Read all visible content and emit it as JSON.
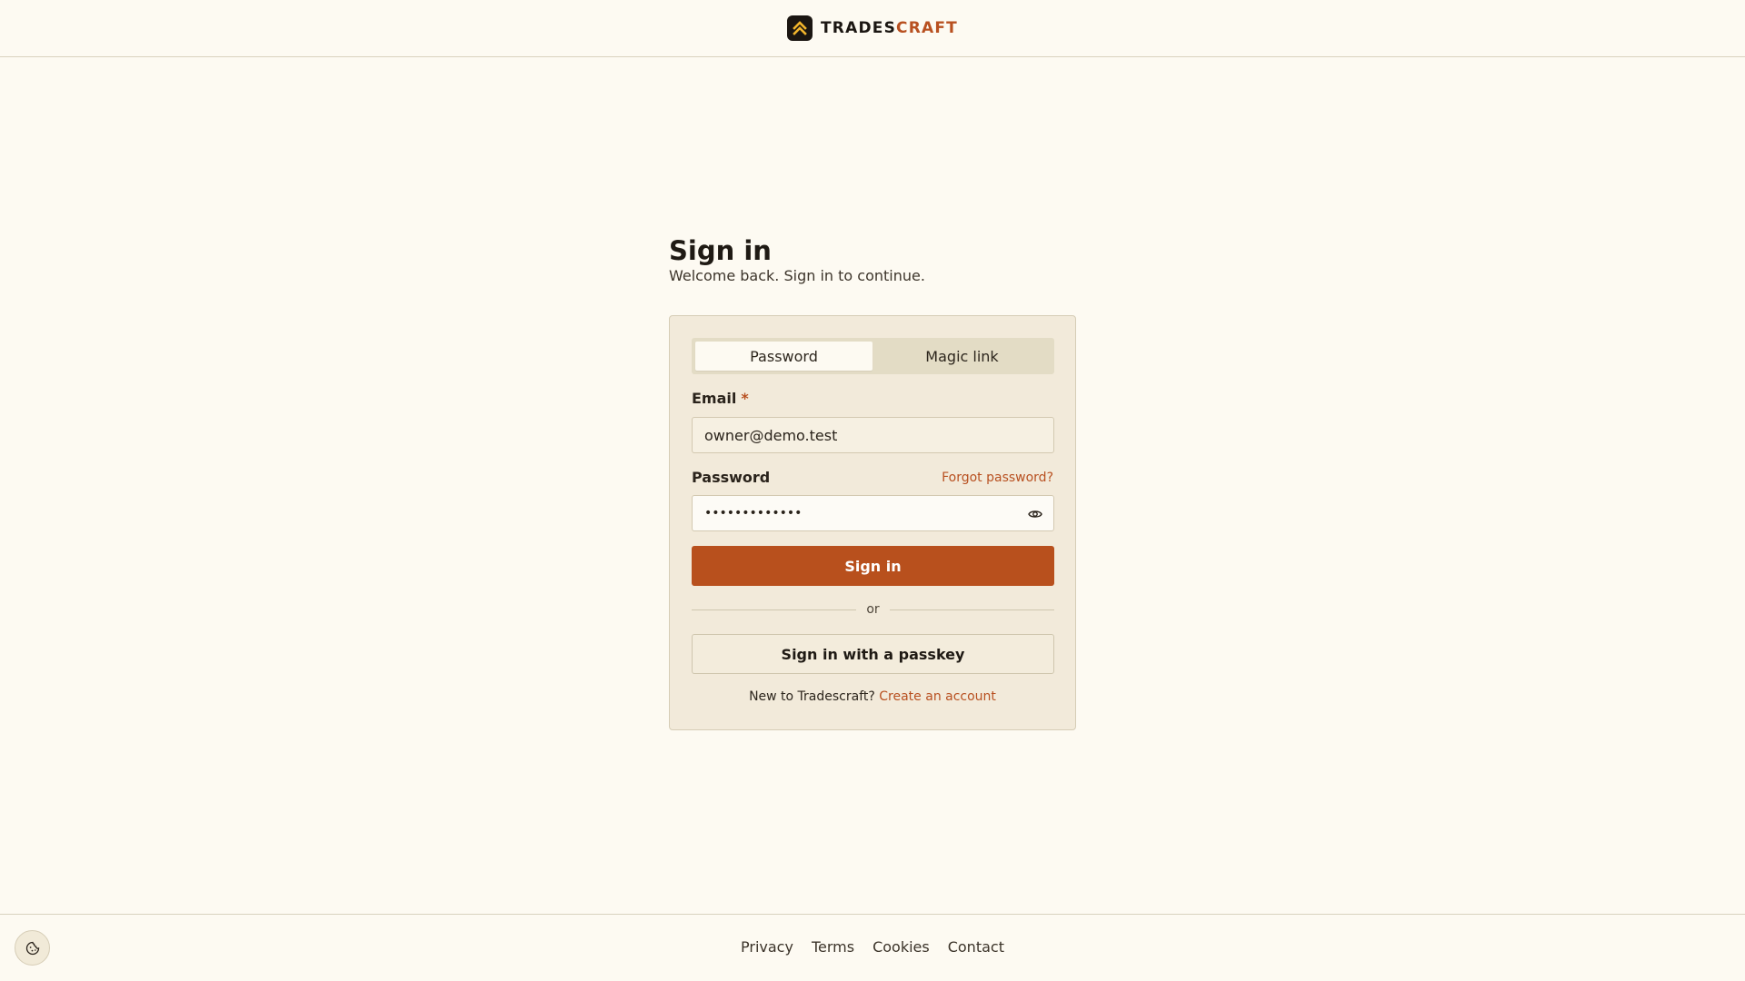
{
  "brand": {
    "name_part1": "TRADES",
    "name_part2": "CRAFT",
    "logo_icon": "chevron-up-icon"
  },
  "heading": {
    "title": "Sign in",
    "subtitle": "Welcome back. Sign in to continue."
  },
  "tabs": [
    {
      "label": "Password",
      "active": true
    },
    {
      "label": "Magic link",
      "active": false
    }
  ],
  "email": {
    "label": "Email",
    "required_mark": "*",
    "value": "owner@demo.test"
  },
  "password": {
    "label": "Password",
    "value_masked": "•••••••••••••",
    "forgot_label": "Forgot password?",
    "toggle_icon": "eye-icon"
  },
  "actions": {
    "signin_label": "Sign in",
    "divider_label": "or",
    "passkey_label": "Sign in with a passkey"
  },
  "signup": {
    "prompt": "New to Tradescraft?",
    "link_label": "Create an account"
  },
  "footer": {
    "links": [
      "Privacy",
      "Terms",
      "Cookies",
      "Contact"
    ],
    "cookie_icon": "cookie-icon"
  },
  "colors": {
    "accent": "#b8501d",
    "background": "#fdfaf2",
    "card": "#f2eada"
  }
}
